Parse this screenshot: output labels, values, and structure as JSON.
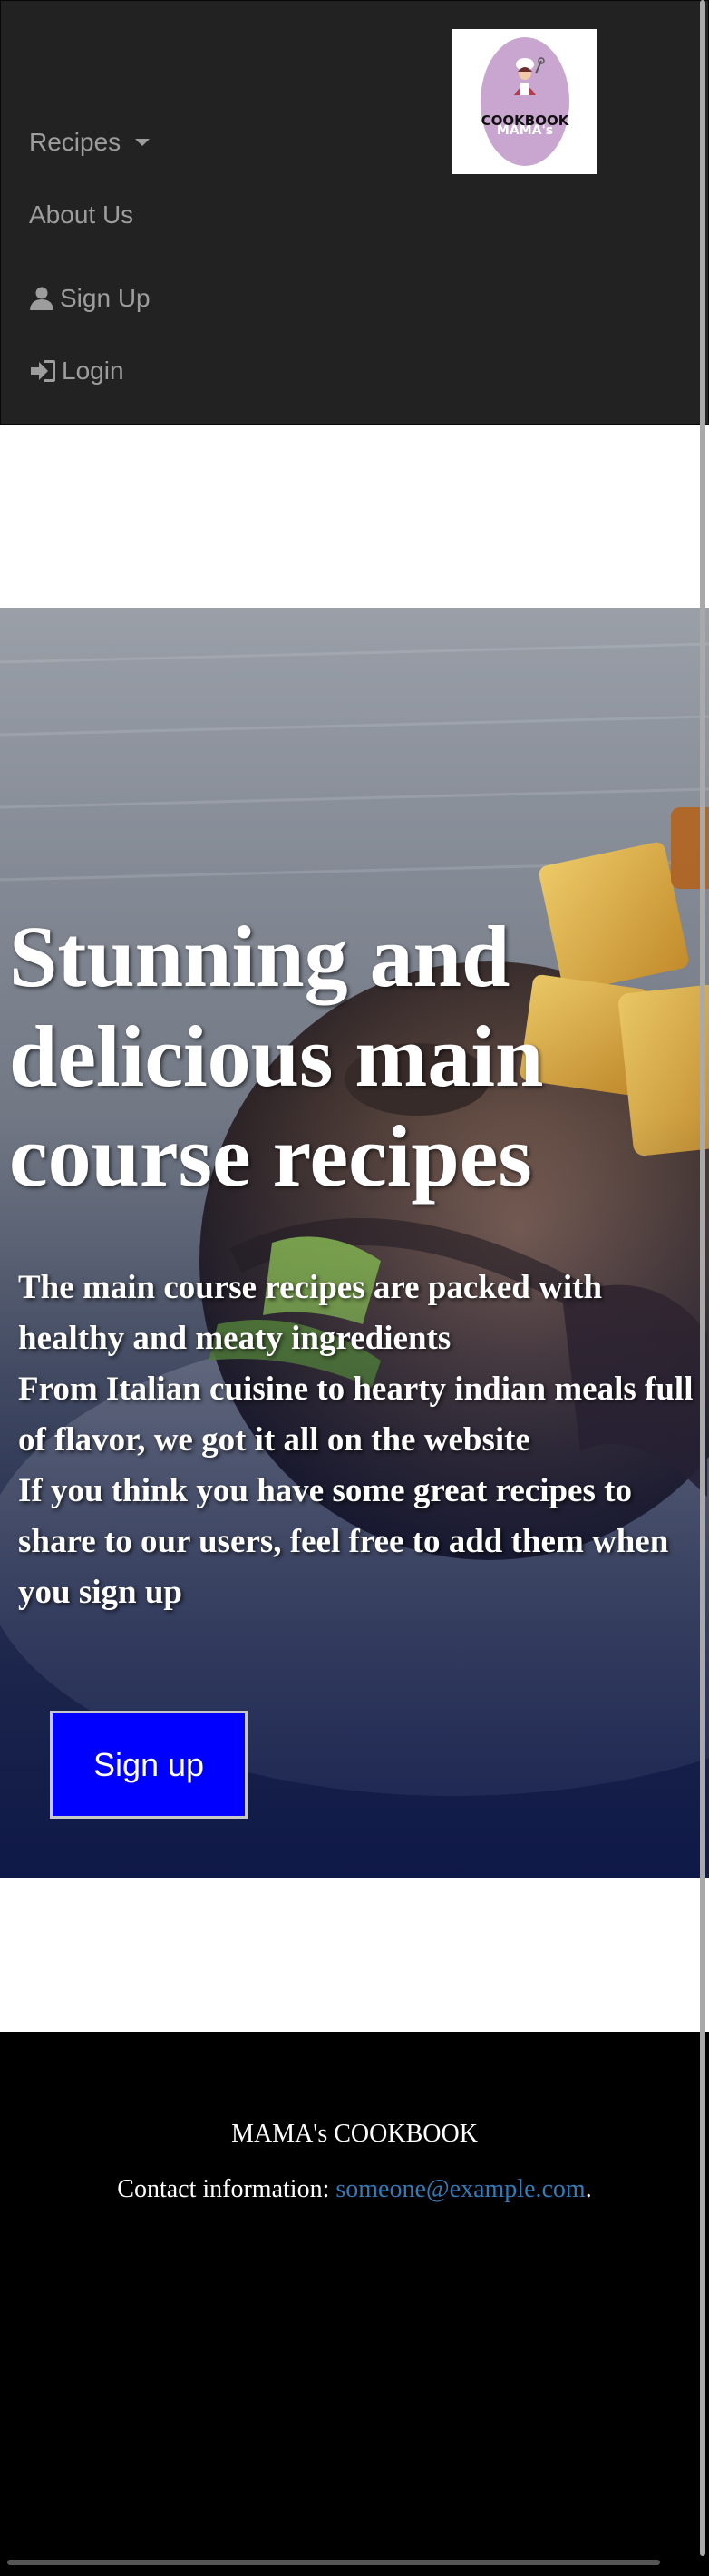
{
  "navbar": {
    "logo": {
      "line1": "MAMA's",
      "line2": "COOKBOOK"
    },
    "items": [
      {
        "label": "Recipes",
        "icon": "caret-down-icon"
      },
      {
        "label": "About Us"
      },
      {
        "label": "Sign Up",
        "icon": "user-icon"
      },
      {
        "label": "Login",
        "icon": "login-icon"
      }
    ]
  },
  "hero": {
    "title": "Stunning and delicious main course recipes",
    "paragraphs": [
      "The main course recipes are packed with healthy and meaty ingredients",
      "From Italian cuisine to hearty indian meals full of flavor, we got it all on the website",
      "If you think you have some great recipes to share to our users, feel free to add them when you sign up"
    ],
    "cta_label": "Sign up",
    "cta_color": "#0000ff"
  },
  "footer": {
    "brand": "MAMA's COOKBOOK",
    "contact_prefix": "Contact information: ",
    "contact_email": "someone@example.com",
    "contact_suffix": "."
  },
  "colors": {
    "navbar_bg": "#222222",
    "nav_text": "#9d9d9d",
    "footer_bg": "#000000",
    "link": "#337ab7"
  }
}
